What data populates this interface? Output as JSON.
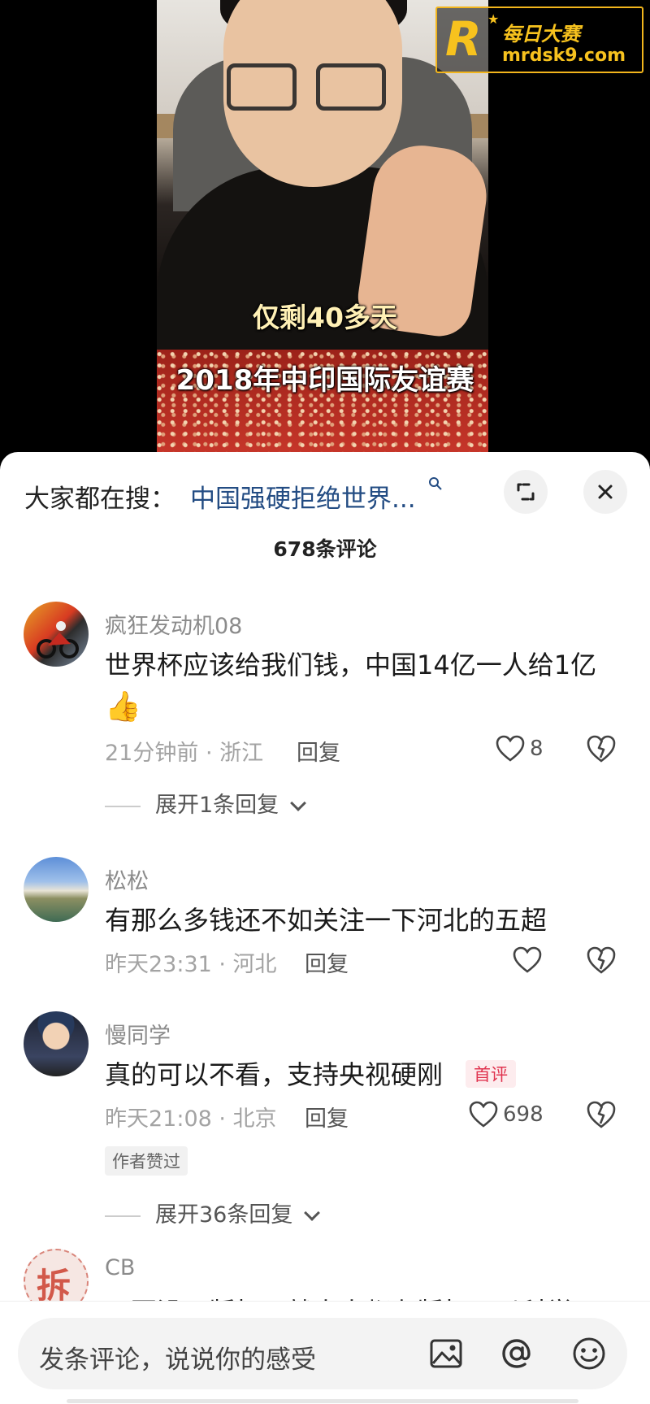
{
  "video": {
    "caption_top": "仅剩40多天",
    "caption_bottom": "2018年中印国际友谊赛"
  },
  "watermark": {
    "logo_letter": "R",
    "cn_name": "每日大赛",
    "url": "mrdsk9.com",
    "color": "#f7c21e"
  },
  "sheet": {
    "search_label": "大家都在搜：",
    "search_link": "中国强硬拒绝世界...",
    "comment_count": "678条评论",
    "link_color": "#234c83"
  },
  "comments": [
    {
      "username": "疯狂发动机08",
      "text": "世界杯应该给我们钱，中国14亿一人给1亿",
      "emoji": "👍",
      "meta": "21分钟前 · 浙江",
      "reply_label": "回复",
      "likes": "8",
      "expand": "展开1条回复"
    },
    {
      "username": "松松",
      "text": "有那么多钱还不如关注一下河北的五超",
      "meta": "昨天23:31 · 河北",
      "reply_label": "回复",
      "likes": ""
    },
    {
      "username": "慢同学",
      "text": "真的可以不看，支持央视硬刚",
      "badge": "首评",
      "meta": "昨天21:08 · 北京",
      "reply_label": "回复",
      "likes": "698",
      "author_badge": "作者赞过",
      "expand": "展开36条回复"
    },
    {
      "username": "CB",
      "text": "只要没了版权，就人人都有版权！以科学"
    }
  ],
  "input": {
    "placeholder": "发条评论，说说你的感受",
    "icons": [
      "image-icon",
      "at-icon",
      "emoji-icon"
    ]
  }
}
